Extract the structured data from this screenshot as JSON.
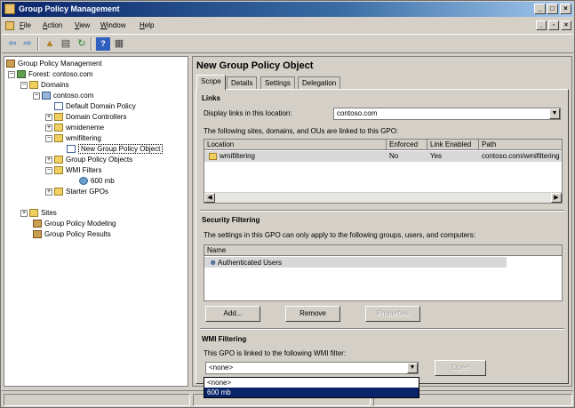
{
  "window": {
    "title": "Group Policy Management"
  },
  "menu": [
    {
      "label": "File",
      "key": "F",
      "rest": "ile"
    },
    {
      "label": "Action",
      "key": "A",
      "rest": "ction"
    },
    {
      "label": "View",
      "key": "V",
      "rest": "iew"
    },
    {
      "label": "Window",
      "key": "W",
      "rest": "indow"
    },
    {
      "label": "Help",
      "key": "H",
      "rest": "elp"
    }
  ],
  "toolbar": [
    "back-icon",
    "forward-icon",
    "up-folder-icon",
    "show-hide-tree-icon",
    "refresh-icon",
    "help-icon",
    "properties-icon"
  ],
  "tree": [
    {
      "label": "Group Policy Management",
      "icon": "gpm",
      "expander": "",
      "depth": 0
    },
    {
      "label": "Forest: contoso.com",
      "icon": "forest",
      "expander": "−",
      "depth": 1
    },
    {
      "label": "Domains",
      "icon": "folder",
      "expander": "−",
      "depth": 2
    },
    {
      "label": "contoso.com",
      "icon": "domain",
      "expander": "−",
      "depth": 3
    },
    {
      "label": "Default Domain Policy",
      "icon": "gpo",
      "expander": "",
      "depth": 4
    },
    {
      "label": "Domain Controllers",
      "icon": "folder",
      "expander": "+",
      "depth": 4
    },
    {
      "label": "wmideneme",
      "icon": "folder",
      "expander": "+",
      "depth": 4
    },
    {
      "label": "wmifiltering",
      "icon": "folder",
      "expander": "−",
      "depth": 4
    },
    {
      "label": "New Group Policy Object",
      "icon": "gpo",
      "expander": "",
      "depth": 5,
      "selected": true
    },
    {
      "label": "Group Policy Objects",
      "icon": "folder",
      "expander": "+",
      "depth": 4
    },
    {
      "label": "WMI Filters",
      "icon": "folder",
      "expander": "−",
      "depth": 4
    },
    {
      "label": "600 mb",
      "icon": "wmi",
      "expander": "",
      "depth": 5
    },
    {
      "label": "Starter GPOs",
      "icon": "folder",
      "expander": "+",
      "depth": 4
    },
    {
      "label": "Sites",
      "icon": "folder",
      "expander": "+",
      "depth": 1
    },
    {
      "label": "Group Policy Modeling",
      "icon": "gpm",
      "expander": "",
      "depth": 1
    },
    {
      "label": "Group Policy Results",
      "icon": "gpm",
      "expander": "",
      "depth": 1
    }
  ],
  "panel": {
    "title": "New Group Policy Object",
    "tabs": [
      "Scope",
      "Details",
      "Settings",
      "Delegation"
    ],
    "active_tab": "Scope"
  },
  "links": {
    "heading": "Links",
    "location_label": "Display links in this location:",
    "location_value": "contoso.com",
    "linked_text": "The following sites, domains, and OUs are linked to this GPO:",
    "columns": [
      "Location",
      "Enforced",
      "Link Enabled",
      "Path"
    ],
    "rows": [
      {
        "location": "wmifiltering",
        "enforced": "No",
        "link_enabled": "Yes",
        "path": "contoso.com/wmifiltering"
      }
    ]
  },
  "security": {
    "heading": "Security Filtering",
    "text": "The settings in this GPO can only apply to the following groups, users, and computers:",
    "column": "Name",
    "rows": [
      "Authenticated Users"
    ],
    "add_label": "Add...",
    "remove_label": "Remove",
    "properties_label": "Properties"
  },
  "wmi": {
    "heading": "WMI Filtering",
    "text": "This GPO is linked to the following WMI filter:",
    "selected": "<none>",
    "options": [
      "<none>",
      "600 mb"
    ],
    "highlighted": "600 mb",
    "open_label": "Open"
  }
}
